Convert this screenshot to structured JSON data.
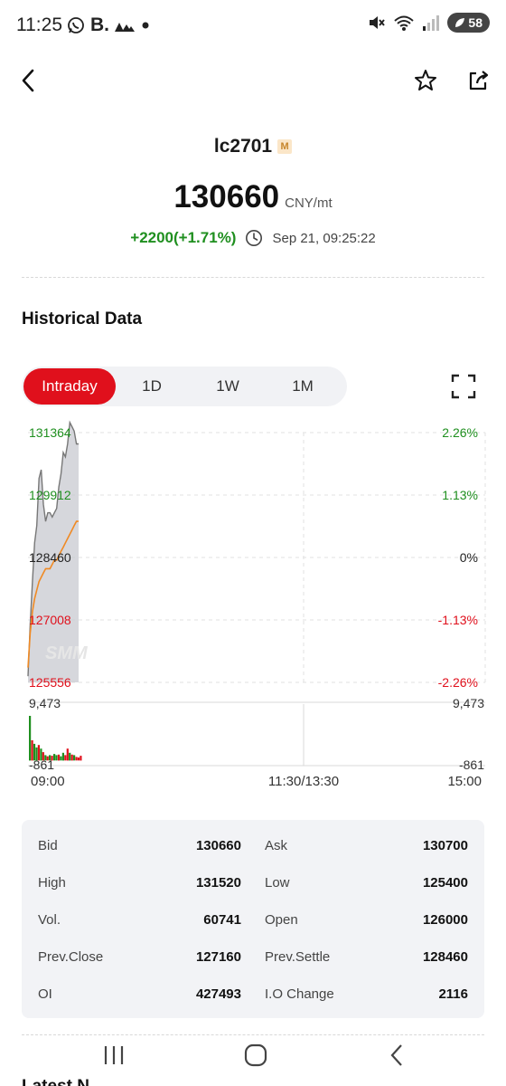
{
  "status_bar": {
    "time": "11:25",
    "left_icons": [
      "whatsapp-icon",
      "b-letter",
      "signal-triangles-icon",
      "dot"
    ],
    "b_label": "B.",
    "battery": "58"
  },
  "instrument": {
    "symbol": "lc2701",
    "badge": "M",
    "price": "130660",
    "unit": "CNY/mt",
    "change": "+2200(+1.71%)",
    "timestamp": "Sep 21, 09:25:22"
  },
  "historical": {
    "title": "Historical Data",
    "tabs": [
      {
        "label": "Intraday",
        "active": true
      },
      {
        "label": "1D",
        "active": false
      },
      {
        "label": "1W",
        "active": false
      },
      {
        "label": "1M",
        "active": false
      }
    ]
  },
  "chart_data": {
    "type": "line",
    "watermark": "SMM",
    "y_left_ticks": [
      "131364",
      "129912",
      "128460",
      "127008",
      "125556"
    ],
    "y_right_ticks": [
      "2.26%",
      "1.13%",
      "0%",
      "-1.13%",
      "-2.26%"
    ],
    "ylim": [
      125556,
      131364
    ],
    "volume_ticks_left": [
      "9,473",
      "-861"
    ],
    "volume_ticks_right": [
      "9,473",
      "-861"
    ],
    "volume_ylim": [
      -861,
      9473
    ],
    "x_ticks": [
      "09:00",
      "11:30/13:30",
      "15:00"
    ],
    "series": [
      {
        "name": "",
        "color": "#777777",
        "values": [
          125700,
          126900,
          127900,
          128800,
          129200,
          130300,
          130500,
          129700,
          129300,
          129500,
          129500,
          129400,
          129500,
          129600,
          130100,
          130400,
          130900,
          130800,
          131100,
          131600,
          131500,
          131400,
          131100,
          131100
        ]
      },
      {
        "name": "",
        "color": "#f08a24",
        "values": [
          125900,
          126700,
          127200,
          127500,
          127700,
          127900,
          128000,
          128100,
          128200,
          128200,
          128200,
          128300,
          128400,
          128400,
          128500,
          128600,
          128700,
          128800,
          128900,
          129000,
          129100,
          129200,
          129300,
          129300
        ]
      }
    ],
    "volume": [
      {
        "v": 7500,
        "c": "green"
      },
      {
        "v": 3400,
        "c": "red"
      },
      {
        "v": 2800,
        "c": "green"
      },
      {
        "v": 2200,
        "c": "green"
      },
      {
        "v": 2600,
        "c": "red"
      },
      {
        "v": 2000,
        "c": "green"
      },
      {
        "v": 1400,
        "c": "red"
      },
      {
        "v": 900,
        "c": "green"
      },
      {
        "v": 700,
        "c": "red"
      },
      {
        "v": 900,
        "c": "green"
      },
      {
        "v": 800,
        "c": "red"
      },
      {
        "v": 1100,
        "c": "green"
      },
      {
        "v": 900,
        "c": "green"
      },
      {
        "v": 1000,
        "c": "red"
      },
      {
        "v": 700,
        "c": "green"
      },
      {
        "v": 1300,
        "c": "green"
      },
      {
        "v": 900,
        "c": "red"
      },
      {
        "v": 2000,
        "c": "red"
      },
      {
        "v": 1300,
        "c": "green"
      },
      {
        "v": 1000,
        "c": "red"
      },
      {
        "v": 900,
        "c": "green"
      },
      {
        "v": 600,
        "c": "red"
      },
      {
        "v": 500,
        "c": "red"
      },
      {
        "v": 800,
        "c": "red"
      }
    ],
    "colors": {
      "up": "#1f8f1f",
      "down": "#e0101c",
      "neutral": "#222222",
      "area": "#c8cad0"
    }
  },
  "stats": [
    {
      "left_label": "Bid",
      "left_value": "130660",
      "right_label": "Ask",
      "right_value": "130700"
    },
    {
      "left_label": "High",
      "left_value": "131520",
      "right_label": "Low",
      "right_value": "125400"
    },
    {
      "left_label": "Vol.",
      "left_value": "60741",
      "right_label": "Open",
      "right_value": "126000"
    },
    {
      "left_label": "Prev.Close",
      "left_value": "127160",
      "right_label": "Prev.Settle",
      "right_value": "128460"
    },
    {
      "left_label": "OI",
      "left_value": "427493",
      "right_label": "I.O Change",
      "right_value": "2116"
    }
  ],
  "latest_peek": "Latest N",
  "colors": {
    "accent": "#e0101c",
    "up": "#1f8f1f"
  }
}
